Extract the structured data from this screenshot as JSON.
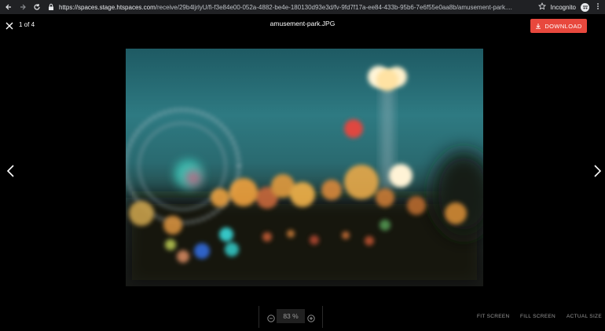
{
  "browser": {
    "url_host": "https://spaces.stage.htspaces.com",
    "url_path": "/receive/29b4ljrlyU/fi-f3e84e00-052a-4882-be4e-180130d93e3d/fv-9fd7f17a-ee84-433b-95b6-7e6f55e0aa8b/amusement-park....",
    "profile_label": "Incognito"
  },
  "viewer": {
    "counter": "1 of 4",
    "filename": "amusement-park.JPG",
    "download_label": "DOWNLOAD"
  },
  "toolbar": {
    "zoom_value": "83 %",
    "fit_label": "FIT SCREEN",
    "fill_label": "FILL SCREEN",
    "actual_label": "ACTUAL SIZE"
  },
  "colors": {
    "download_bg": "#e8483d",
    "background": "#000000",
    "chrome_bg": "#202124"
  },
  "icons": [
    "back-arrow-icon",
    "forward-arrow-icon",
    "reload-icon",
    "lock-icon",
    "star-icon",
    "incognito-icon",
    "kebab-menu-icon",
    "close-icon",
    "download-icon",
    "chevron-left-icon",
    "chevron-right-icon",
    "zoom-out-icon",
    "zoom-in-icon"
  ]
}
